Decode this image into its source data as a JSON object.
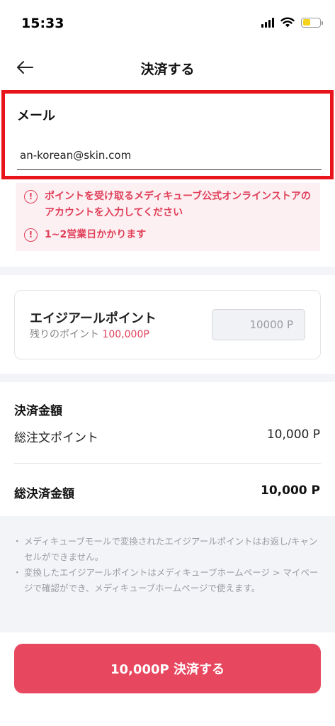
{
  "status_bar": {
    "time": "15:33"
  },
  "header": {
    "title": "決済する"
  },
  "email": {
    "label": "メール",
    "value": "an-korean@skin.com"
  },
  "warnings": [
    "ポイントを受け取るメディキューブ公式オンラインストアのアカウントを入力してください",
    "1~2営業日かかります"
  ],
  "points": {
    "title": "エイジアールポイント",
    "remaining_label": "残りのポイント",
    "remaining_value": "100,000P",
    "input_value": "10000 P"
  },
  "payment": {
    "section_title": "決済金額",
    "order_label": "総注文ポイント",
    "order_value": "10,000 P",
    "total_label": "総決済金額",
    "total_value": "10,000 P"
  },
  "notes": [
    "メディキューブモールで変換されたエイジアールポイントはお返し/キャンセルができません。",
    "変換したエイジアールポイントはメディキューブホームページ > マイページで確認ができ、メディキューブホームページで使えます。"
  ],
  "pay_button": {
    "label": "10,000P 決済する"
  },
  "colors": {
    "accent": "#e8485f",
    "highlight_border": "#e8141c",
    "warning_text": "#e0405a"
  }
}
